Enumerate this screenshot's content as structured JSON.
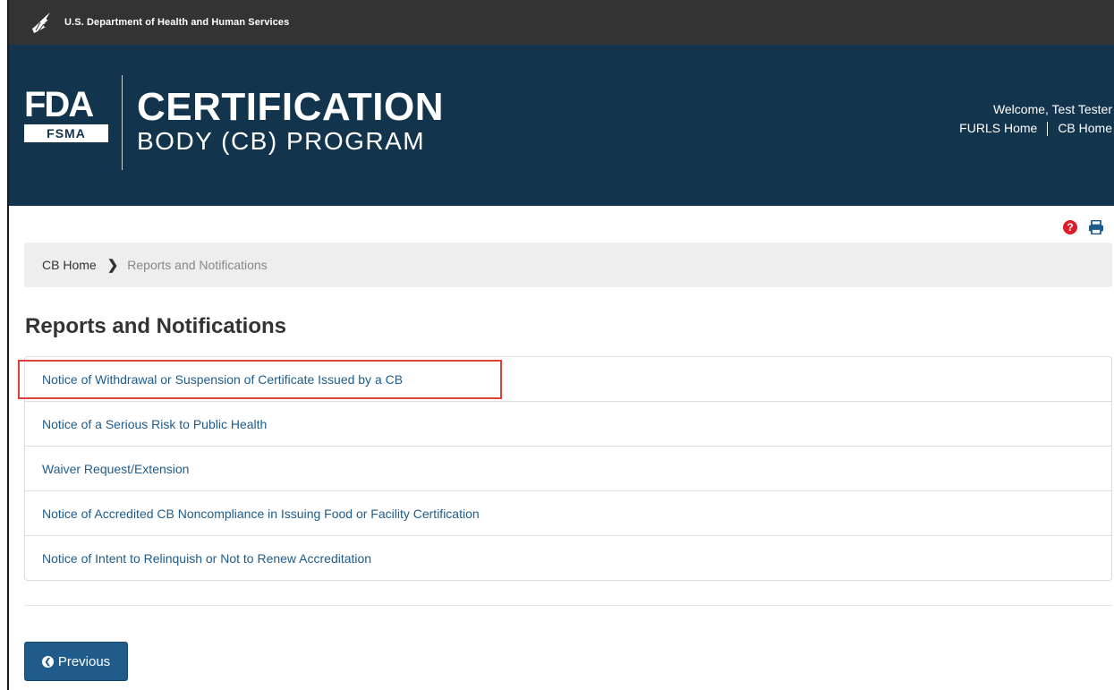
{
  "hhs_bar": {
    "text": "U.S. Department of Health and Human Services",
    "icon": "hhs-eagle-icon"
  },
  "banner": {
    "logo": {
      "fda": "FDA",
      "fsma": "FSMA"
    },
    "title_line1": "CERTIFICATION",
    "title_line2": "BODY (CB) PROGRAM",
    "welcome": "Welcome, Test Tester",
    "furls_home": "FURLS Home",
    "cb_home": "CB Home"
  },
  "tools": {
    "help_icon": "question-circle-icon",
    "help_glyph": "?",
    "print_icon": "print-icon"
  },
  "breadcrumb": {
    "home": "CB Home",
    "separator_icon": "chevron-right-icon",
    "separator_glyph": "❯",
    "current": "Reports and Notifications"
  },
  "page_title": "Reports and Notifications",
  "reports": [
    "Notice of Withdrawal or Suspension of Certificate Issued by a CB",
    "Notice of a Serious Risk to Public Health",
    "Waiver Request/Extension",
    "Notice of Accredited CB Noncompliance in Issuing Food or Facility Certification",
    "Notice of Intent to Relinquish or Not to Renew Accreditation"
  ],
  "previous_button": {
    "label": "Previous",
    "icon": "chevron-circle-left-icon",
    "glyph": "❮"
  },
  "colors": {
    "banner": "#12344d",
    "top_bar": "#333333",
    "link": "#1f5c8b",
    "highlight": "#e0403c",
    "help": "#dd1e2a"
  }
}
